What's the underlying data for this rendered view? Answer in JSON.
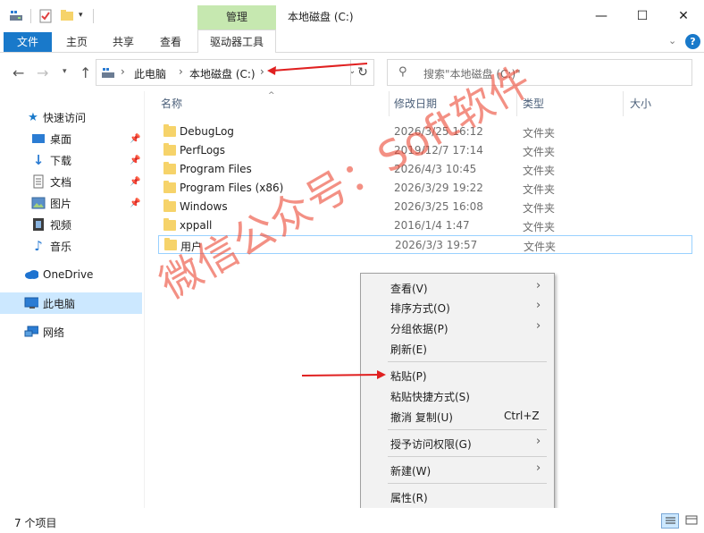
{
  "window": {
    "title": "本地磁盘 (C:)",
    "context_tab": "管理",
    "minimize": "—",
    "maximize": "☐",
    "close": "✕"
  },
  "ribbon": {
    "tabs": [
      "文件",
      "主页",
      "共享",
      "查看",
      "驱动器工具"
    ],
    "expand_icon": "chevron-down-icon",
    "help_label": "?"
  },
  "address": {
    "segments": [
      "此电脑",
      "本地磁盘 (C:)"
    ],
    "search_placeholder": "搜索\"本地磁盘 (C:)\""
  },
  "sidebar": {
    "items": [
      {
        "label": "快速访问",
        "icon": "star-icon",
        "pinned": false
      },
      {
        "label": "桌面",
        "icon": "desktop-icon",
        "pinned": true
      },
      {
        "label": "下载",
        "icon": "download-icon",
        "pinned": true
      },
      {
        "label": "文档",
        "icon": "document-icon",
        "pinned": true
      },
      {
        "label": "图片",
        "icon": "picture-icon",
        "pinned": true
      },
      {
        "label": "视频",
        "icon": "video-icon",
        "pinned": false
      },
      {
        "label": "音乐",
        "icon": "music-icon",
        "pinned": false
      },
      {
        "label": "OneDrive",
        "icon": "cloud-icon",
        "pinned": false
      },
      {
        "label": "此电脑",
        "icon": "computer-icon",
        "pinned": false
      },
      {
        "label": "网络",
        "icon": "network-icon",
        "pinned": false
      }
    ]
  },
  "list": {
    "columns": [
      "名称",
      "修改日期",
      "类型",
      "大小"
    ],
    "rows": [
      {
        "name": "DebugLog",
        "date": "2026/3/25 16:12",
        "type": "文件夹"
      },
      {
        "name": "PerfLogs",
        "date": "2019/12/7 17:14",
        "type": "文件夹"
      },
      {
        "name": "Program Files",
        "date": "2026/4/3 10:45",
        "type": "文件夹"
      },
      {
        "name": "Program Files (x86)",
        "date": "2026/3/29 19:22",
        "type": "文件夹"
      },
      {
        "name": "Windows",
        "date": "2026/3/25 16:08",
        "type": "文件夹"
      },
      {
        "name": "xppall",
        "date": "2016/1/4 1:47",
        "type": "文件夹"
      },
      {
        "name": "用户",
        "date": "2026/3/3 19:57",
        "type": "文件夹"
      }
    ]
  },
  "context_menu": {
    "items": [
      {
        "label": "查看(V)",
        "submenu": true
      },
      {
        "label": "排序方式(O)",
        "submenu": true
      },
      {
        "label": "分组依据(P)",
        "submenu": true
      },
      {
        "label": "刷新(E)",
        "submenu": false
      },
      {
        "label": "粘贴(P)",
        "submenu": false
      },
      {
        "label": "粘贴快捷方式(S)",
        "submenu": false
      },
      {
        "label": "撤消 复制(U)",
        "shortcut": "Ctrl+Z",
        "submenu": false
      },
      {
        "label": "授予访问权限(G)",
        "submenu": true
      },
      {
        "label": "新建(W)",
        "submenu": true
      },
      {
        "label": "属性(R)",
        "submenu": false
      }
    ]
  },
  "status": {
    "item_count": "7 个项目"
  },
  "watermark": "微信公众号：Soft软件",
  "colors": {
    "accent": "#1979ca",
    "manage_tab": "#c6e8b0",
    "selected": "#cce8ff",
    "annotation_red": "#e02020"
  }
}
